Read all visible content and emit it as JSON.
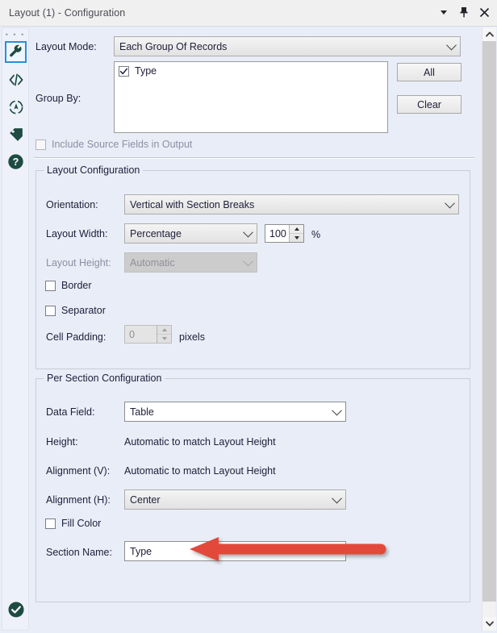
{
  "window": {
    "title": "Layout (1) - Configuration",
    "controls": [
      {
        "name": "dropdown-caret",
        "icon": "caret-down-icon"
      },
      {
        "name": "pin",
        "icon": "pin-icon"
      },
      {
        "name": "close",
        "icon": "close-icon"
      }
    ]
  },
  "rail": {
    "drag_handle": "• • •",
    "items": [
      {
        "icon": "wrench-icon",
        "selected": true
      },
      {
        "icon": "code-brackets-icon",
        "selected": false
      },
      {
        "icon": "globe-target-icon",
        "selected": false
      },
      {
        "icon": "tag-icon",
        "selected": false
      },
      {
        "icon": "help-question-icon",
        "selected": false
      }
    ],
    "status_icon": "green-check-circle-icon"
  },
  "scrollbar": {
    "up_icon": "chevron-up-icon",
    "down_icon": "chevron-down-icon"
  },
  "top": {
    "layout_mode_label": "Layout Mode:",
    "layout_mode_value": "Each Group Of Records",
    "group_by_label": "Group By:",
    "group_by_items": [
      {
        "label": "Type",
        "checked": true
      }
    ],
    "all_button": "All",
    "clear_button": "Clear",
    "include_source_fields_label": "Include Source Fields in Output",
    "include_source_fields_checked": false,
    "include_source_fields_disabled": true
  },
  "layout_configuration": {
    "title": "Layout Configuration",
    "orientation_label": "Orientation:",
    "orientation_value": "Vertical with Section Breaks",
    "layout_width_label": "Layout Width:",
    "layout_width_value": "Percentage",
    "layout_width_amount": "100",
    "layout_width_unit": "%",
    "layout_height_label": "Layout Height:",
    "layout_height_value": "Automatic",
    "layout_height_disabled": true,
    "border_label": "Border",
    "border_checked": false,
    "separator_label": "Separator",
    "separator_checked": false,
    "cell_padding_label": "Cell Padding:",
    "cell_padding_value": "0",
    "cell_padding_unit": "pixels",
    "cell_padding_disabled": true
  },
  "per_section_configuration": {
    "title": "Per Section Configuration",
    "data_field_label": "Data Field:",
    "data_field_value": "Table",
    "height_label": "Height:",
    "height_value": "Automatic to match Layout Height",
    "alignment_v_label": "Alignment (V):",
    "alignment_v_value": "Automatic to match Layout Height",
    "alignment_h_label": "Alignment (H):",
    "alignment_h_value": "Center",
    "fill_color_label": "Fill Color",
    "fill_color_checked": false,
    "section_name_label": "Section Name:",
    "section_name_value": "Type"
  },
  "annotation": {
    "type": "arrow-left",
    "color": "#e2483a",
    "points_at": "section-name-input"
  }
}
